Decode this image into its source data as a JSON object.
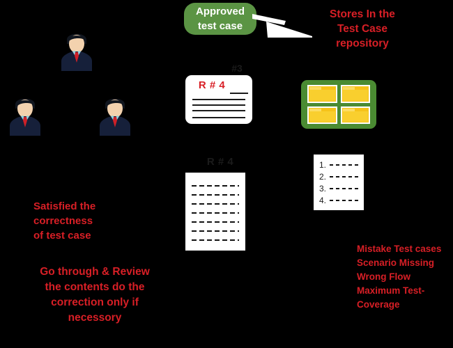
{
  "diagram": {
    "title": "Test Case Review and Approval Flow",
    "background_color": "#000000",
    "accent_red": "#d81f26",
    "accent_green": "#5b9444",
    "repository_green": "#4a8b32",
    "folder_yellow": "#f6c319"
  },
  "pill": {
    "label": "Approved\ntest case",
    "line1": "Approved",
    "line2": "test case"
  },
  "arrow": {
    "name": "white-arrow",
    "color": "#ffffff"
  },
  "annotations": {
    "stores": {
      "line1": "Stores In the",
      "line2": "Test Case",
      "line3": "repository"
    },
    "satisfied": {
      "line1": "Satisfied the",
      "line2": "correctness",
      "line3": "of test case"
    },
    "review": {
      "line1": "Go through & Review",
      "line2": "the contents do the",
      "line3": "correction only if",
      "line4": "necessory"
    },
    "mistakes": {
      "line1": "Mistake Test cases",
      "line2": "Scenario Missing",
      "line3": "Wrong Flow",
      "line4": "Maximum Test-",
      "line5": "Coverage"
    }
  },
  "people": [
    {
      "name": "reviewer-top",
      "label": "reviewer"
    },
    {
      "name": "reviewer-left",
      "label": "reviewer"
    },
    {
      "name": "reviewer-right",
      "label": "reviewer"
    }
  ],
  "card": {
    "title": "R # 4",
    "line_count": 4
  },
  "ghosts": {
    "hash3": "#3",
    "r4": "R # 4"
  },
  "repository": {
    "folder_count": 4,
    "folders": [
      "folder-1",
      "folder-2",
      "folder-3",
      "folder-4"
    ]
  },
  "document": {
    "line_count": 7
  },
  "list_card": {
    "items": [
      "1.",
      "2.",
      "3.",
      "4."
    ]
  }
}
